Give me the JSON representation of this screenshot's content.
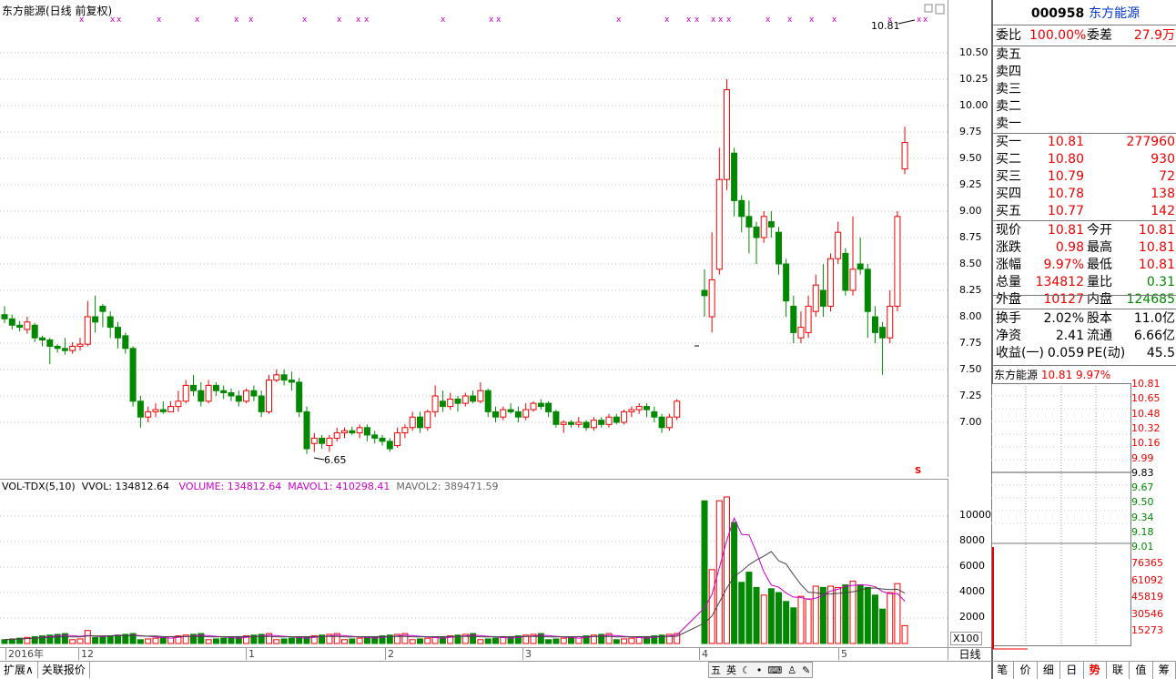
{
  "stock": {
    "code": "000958",
    "name": "东方能源",
    "chart_title": "东方能源(日线 前复权)",
    "period": "日线",
    "mini_title": "东方能源",
    "mini_price": "10.81",
    "mini_pct": "9.97%"
  },
  "price_axis": [
    "10.50",
    "10.25",
    "10.00",
    "9.75",
    "9.50",
    "9.25",
    "9.00",
    "8.75",
    "8.50",
    "8.25",
    "8.00",
    "7.75",
    "7.50",
    "7.25",
    "7.00"
  ],
  "annotations": {
    "high_label": "10.81",
    "low_label": "6.65",
    "s_marker": "S"
  },
  "volume": {
    "title": "VOL-TDX(5,10)",
    "vvol": "VVOL: 134812.64",
    "volume": "VOLUME: 134812.64",
    "mavol1": "MAVOL1: 410298.41",
    "mavol2": "MAVOL2: 389471.59",
    "axis": [
      "10000",
      "8000",
      "6000",
      "4000",
      "2000"
    ],
    "unit": "X100"
  },
  "dates": [
    "2016年",
    "12",
    "1",
    "2",
    "3",
    "4",
    "5"
  ],
  "bottom_tabs": [
    "扩展∧",
    "关联报价"
  ],
  "ime": [
    "五",
    "英"
  ],
  "right_tabs": [
    "笔",
    "价",
    "细",
    "日",
    "势",
    "联",
    "值",
    "筹"
  ],
  "quote": {
    "weibi_label": "委比",
    "weibi": "100.00%",
    "weicha_label": "委差",
    "weicha": "27.9万",
    "sells": [
      "卖五",
      "卖四",
      "卖三",
      "卖二",
      "卖一"
    ],
    "buys": [
      {
        "label": "买一",
        "price": "10.81",
        "vol": "277960"
      },
      {
        "label": "买二",
        "price": "10.80",
        "vol": "930"
      },
      {
        "label": "买三",
        "price": "10.79",
        "vol": "72"
      },
      {
        "label": "买四",
        "price": "10.78",
        "vol": "138"
      },
      {
        "label": "买五",
        "price": "10.77",
        "vol": "142"
      }
    ],
    "stats": [
      {
        "l1": "现价",
        "v1": "10.81",
        "l2": "今开",
        "v2": "10.81"
      },
      {
        "l1": "涨跌",
        "v1": "0.98",
        "l2": "最高",
        "v2": "10.81"
      },
      {
        "l1": "涨幅",
        "v1": "9.97%",
        "l2": "最低",
        "v2": "10.81"
      },
      {
        "l1": "总量",
        "v1": "134812",
        "l2": "量比",
        "v2": "0.31"
      },
      {
        "l1": "外盘",
        "v1": "10127",
        "l2": "内盘",
        "v2": "124685"
      }
    ],
    "info": [
      {
        "l1": "换手",
        "v1": "2.02%",
        "l2": "股本",
        "v2": "11.0亿"
      },
      {
        "l1": "净资",
        "v1": "2.41",
        "l2": "流通",
        "v2": "6.66亿"
      },
      {
        "l1": "收益(一)",
        "v1": "0.059",
        "l2": "PE(动)",
        "v2": "45.5"
      }
    ]
  },
  "mini_axis": [
    "10.81",
    "10.65",
    "10.48",
    "10.32",
    "10.16",
    "9.99",
    "9.83",
    "9.67",
    "9.50",
    "9.34",
    "9.18",
    "9.01"
  ],
  "mini_vol_axis": [
    "76365",
    "61092",
    "45819",
    "30546",
    "15273"
  ],
  "chart_data": {
    "type": "candlestick",
    "note": "daily K-line, prices in CNY",
    "candles": [
      [
        8.02,
        7.98,
        8.1,
        7.94
      ],
      [
        7.98,
        7.92,
        8.02,
        7.88
      ],
      [
        7.92,
        7.9,
        7.96,
        7.86
      ],
      [
        7.88,
        7.95,
        8.0,
        7.84
      ],
      [
        7.92,
        7.8,
        7.94,
        7.76
      ],
      [
        7.8,
        7.78,
        7.82,
        7.72
      ],
      [
        7.78,
        7.72,
        7.8,
        7.55
      ],
      [
        7.72,
        7.7,
        7.74,
        7.66
      ],
      [
        7.7,
        7.68,
        7.8,
        7.64
      ],
      [
        7.68,
        7.72,
        7.76,
        7.65
      ],
      [
        7.72,
        7.74,
        7.8,
        7.68
      ],
      [
        7.74,
        8.0,
        8.15,
        7.72
      ],
      [
        8.0,
        7.95,
        8.2,
        7.85
      ],
      [
        8.1,
        8.05,
        8.12,
        7.9
      ],
      [
        8.0,
        7.9,
        8.05,
        7.8
      ],
      [
        7.9,
        7.8,
        7.95,
        7.7
      ],
      [
        7.82,
        7.7,
        7.85,
        7.65
      ],
      [
        7.7,
        7.2,
        7.72,
        7.15
      ],
      [
        7.2,
        7.05,
        7.25,
        6.95
      ],
      [
        7.05,
        7.1,
        7.15,
        7.0
      ],
      [
        7.1,
        7.12,
        7.18,
        7.05
      ],
      [
        7.12,
        7.1,
        7.2,
        7.08
      ],
      [
        7.1,
        7.15,
        7.2,
        7.12
      ],
      [
        7.15,
        7.2,
        7.3,
        7.1
      ],
      [
        7.2,
        7.35,
        7.4,
        7.18
      ],
      [
        7.35,
        7.3,
        7.45,
        7.25
      ],
      [
        7.3,
        7.2,
        7.38,
        7.15
      ],
      [
        7.2,
        7.35,
        7.4,
        7.18
      ],
      [
        7.35,
        7.3,
        7.38,
        7.25
      ],
      [
        7.3,
        7.28,
        7.35,
        7.22
      ],
      [
        7.28,
        7.25,
        7.32,
        7.2
      ],
      [
        7.25,
        7.2,
        7.3,
        7.15
      ],
      [
        7.2,
        7.3,
        7.32,
        7.18
      ],
      [
        7.3,
        7.25,
        7.35,
        7.2
      ],
      [
        7.25,
        7.1,
        7.3,
        7.05
      ],
      [
        7.1,
        7.4,
        7.45,
        7.08
      ],
      [
        7.4,
        7.45,
        7.5,
        7.38
      ],
      [
        7.45,
        7.4,
        7.5,
        7.35
      ],
      [
        7.4,
        7.38,
        7.48,
        7.3
      ],
      [
        7.38,
        7.1,
        7.42,
        7.05
      ],
      [
        7.1,
        6.75,
        7.15,
        6.7
      ],
      [
        6.8,
        6.85,
        6.9,
        6.72
      ],
      [
        6.85,
        6.8,
        6.88,
        6.75
      ],
      [
        6.78,
        6.85,
        6.88,
        6.72
      ],
      [
        6.85,
        6.9,
        6.95,
        6.82
      ],
      [
        6.9,
        6.92,
        6.95,
        6.85
      ],
      [
        6.92,
        6.9,
        6.96,
        6.88
      ],
      [
        6.9,
        6.95,
        6.98,
        6.85
      ],
      [
        6.95,
        6.88,
        6.98,
        6.82
      ],
      [
        6.88,
        6.85,
        6.92,
        6.8
      ],
      [
        6.85,
        6.82,
        6.88,
        6.78
      ],
      [
        6.82,
        6.75,
        6.85,
        6.72
      ],
      [
        6.78,
        6.9,
        6.95,
        6.76
      ],
      [
        6.9,
        6.95,
        6.98,
        6.85
      ],
      [
        6.95,
        7.05,
        7.1,
        6.92
      ],
      [
        7.05,
        6.95,
        7.1,
        6.9
      ],
      [
        6.95,
        7.1,
        7.12,
        6.92
      ],
      [
        7.1,
        7.25,
        7.35,
        7.05
      ],
      [
        7.2,
        7.15,
        7.3,
        7.1
      ],
      [
        7.15,
        7.22,
        7.28,
        7.12
      ],
      [
        7.22,
        7.18,
        7.25,
        7.1
      ],
      [
        7.18,
        7.25,
        7.28,
        7.15
      ],
      [
        7.25,
        7.2,
        7.3,
        7.18
      ],
      [
        7.2,
        7.3,
        7.38,
        7.18
      ],
      [
        7.3,
        7.1,
        7.32,
        7.05
      ],
      [
        7.1,
        7.05,
        7.15,
        7.0
      ],
      [
        7.05,
        7.12,
        7.15,
        7.02
      ],
      [
        7.12,
        7.1,
        7.18,
        7.08
      ],
      [
        7.1,
        7.05,
        7.15,
        7.0
      ],
      [
        7.05,
        7.12,
        7.18,
        7.02
      ],
      [
        7.12,
        7.18,
        7.2,
        7.1
      ],
      [
        7.18,
        7.15,
        7.22,
        7.12
      ],
      [
        7.18,
        7.1,
        7.2,
        7.05
      ],
      [
        7.1,
        6.98,
        7.12,
        6.95
      ],
      [
        6.98,
        7.0,
        7.02,
        6.9
      ],
      [
        7.0,
        6.98,
        7.02,
        6.95
      ],
      [
        6.98,
        7.0,
        7.05,
        6.95
      ],
      [
        7.0,
        6.95,
        7.02,
        6.92
      ],
      [
        6.95,
        7.02,
        7.05,
        6.92
      ],
      [
        7.02,
        6.98,
        7.05,
        6.95
      ],
      [
        6.98,
        7.05,
        7.08,
        6.95
      ],
      [
        7.05,
        7.0,
        7.08,
        6.98
      ],
      [
        7.0,
        7.1,
        7.12,
        6.98
      ],
      [
        7.1,
        7.12,
        7.15,
        7.05
      ],
      [
        7.12,
        7.15,
        7.18,
        7.08
      ],
      [
        7.15,
        7.12,
        7.18,
        7.05
      ],
      [
        7.1,
        7.05,
        7.15,
        7.0
      ],
      [
        7.05,
        6.95,
        7.08,
        6.9
      ],
      [
        6.95,
        7.05,
        7.08,
        6.92
      ],
      [
        7.05,
        7.2,
        7.22,
        7.02
      ],
      [
        8.25,
        8.2,
        8.45,
        8.0
      ],
      [
        8.0,
        8.35,
        8.8,
        7.85
      ],
      [
        8.45,
        9.3,
        9.6,
        8.4
      ],
      [
        9.3,
        10.15,
        10.25,
        9.2
      ],
      [
        9.55,
        9.1,
        9.6,
        8.95
      ],
      [
        9.1,
        8.95,
        9.15,
        8.8
      ],
      [
        8.95,
        8.85,
        9.1,
        8.6
      ],
      [
        8.85,
        8.75,
        8.9,
        8.5
      ],
      [
        8.75,
        8.95,
        9.0,
        8.7
      ],
      [
        8.9,
        8.85,
        9.0,
        8.75
      ],
      [
        8.8,
        8.5,
        8.85,
        8.4
      ],
      [
        8.5,
        8.15,
        8.55,
        8.0
      ],
      [
        8.1,
        7.85,
        8.2,
        7.75
      ],
      [
        7.8,
        7.9,
        8.05,
        7.75
      ],
      [
        7.85,
        8.1,
        8.2,
        7.8
      ],
      [
        8.05,
        8.3,
        8.4,
        8.0
      ],
      [
        8.25,
        8.1,
        8.5,
        8.0
      ],
      [
        8.1,
        8.55,
        8.6,
        8.05
      ],
      [
        8.55,
        8.8,
        8.9,
        8.5
      ],
      [
        8.6,
        8.25,
        8.65,
        8.2
      ],
      [
        8.25,
        8.45,
        8.95,
        8.2
      ],
      [
        8.5,
        8.45,
        8.75,
        8.4
      ],
      [
        8.45,
        8.05,
        8.5,
        7.8
      ],
      [
        8.0,
        7.85,
        8.1,
        7.75
      ],
      [
        7.9,
        7.8,
        7.95,
        7.45
      ],
      [
        7.8,
        8.1,
        8.25,
        7.75
      ],
      [
        8.1,
        8.95,
        9.0,
        8.05
      ],
      [
        9.4,
        9.65,
        9.8,
        9.35
      ]
    ]
  }
}
